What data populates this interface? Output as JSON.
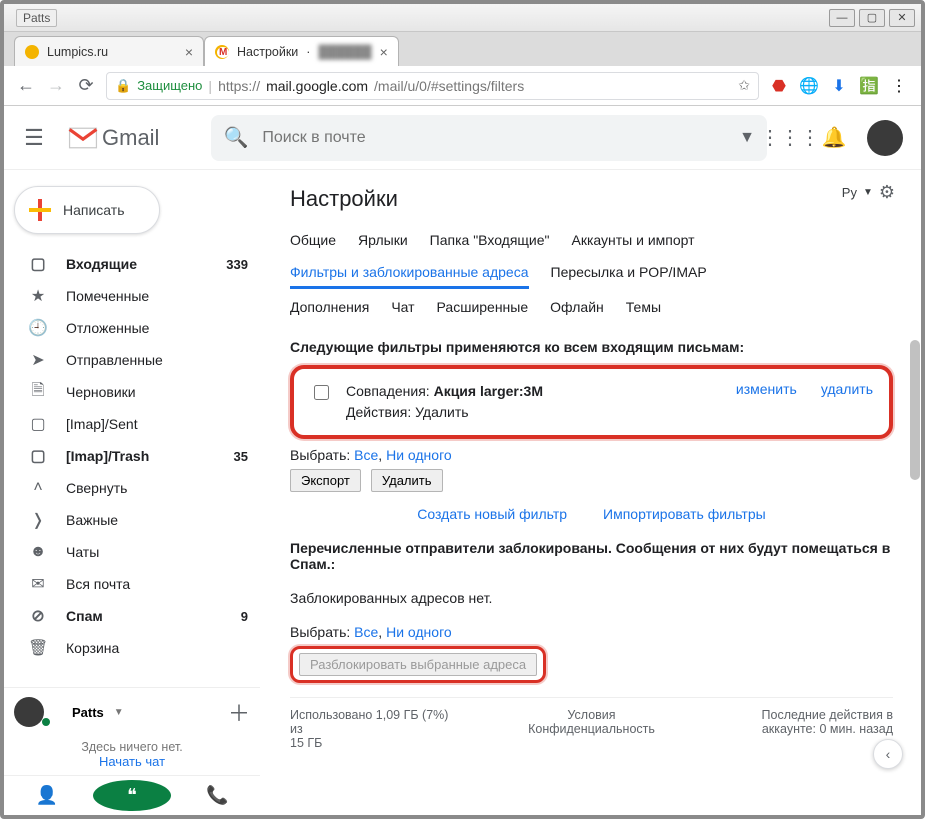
{
  "window": {
    "app_label": "Patts"
  },
  "browser": {
    "tabs": [
      {
        "title": "Lumpics.ru"
      },
      {
        "title": "Настройки"
      }
    ],
    "url_secure": "Защищено",
    "url_host": "https://",
    "url_main": "mail.google.com",
    "url_path": "/mail/u/0/#settings/filters"
  },
  "header": {
    "brand": "Gmail",
    "search_placeholder": "Поиск в почте"
  },
  "compose_label": "Написать",
  "sidebar": {
    "items": [
      {
        "label": "Входящие",
        "count": "339",
        "bold": true,
        "icon": "▢"
      },
      {
        "label": "Помеченные",
        "count": "",
        "bold": false,
        "icon": "★"
      },
      {
        "label": "Отложенные",
        "count": "",
        "bold": false,
        "icon": "🕘"
      },
      {
        "label": "Отправленные",
        "count": "",
        "bold": false,
        "icon": "➤"
      },
      {
        "label": "Черновики",
        "count": "",
        "bold": false,
        "icon": "🗎"
      },
      {
        "label": "[Imap]/Sent",
        "count": "",
        "bold": false,
        "icon": "▢"
      },
      {
        "label": "[Imap]/Trash",
        "count": "35",
        "bold": true,
        "icon": "▢"
      },
      {
        "label": "Свернуть",
        "count": "",
        "bold": false,
        "icon": "˄"
      },
      {
        "label": "Важные",
        "count": "",
        "bold": false,
        "icon": "❭"
      },
      {
        "label": "Чаты",
        "count": "",
        "bold": false,
        "icon": "☻"
      },
      {
        "label": "Вся почта",
        "count": "",
        "bold": false,
        "icon": "✉"
      },
      {
        "label": "Спам",
        "count": "9",
        "bold": true,
        "icon": "⊘"
      },
      {
        "label": "Корзина",
        "count": "",
        "bold": false,
        "icon": "🗑"
      }
    ]
  },
  "hangouts": {
    "user": "Patts",
    "empty": "Здесь ничего нет.",
    "start_chat": "Начать чат"
  },
  "settings": {
    "title": "Настройки",
    "lang": "Ру",
    "tabs": {
      "general": "Общие",
      "labels": "Ярлыки",
      "inbox": "Папка \"Входящие\"",
      "accounts": "Аккаунты и импорт",
      "filters": "Фильтры и заблокированные адреса",
      "forwarding": "Пересылка и POP/IMAP",
      "addons": "Дополнения",
      "chat": "Чат",
      "advanced": "Расширенные",
      "offline": "Офлайн",
      "themes": "Темы"
    },
    "filters_heading": "Следующие фильтры применяются ко всем входящим письмам:",
    "filter": {
      "match_label": "Совпадения:",
      "match_value": "Акция larger:3M",
      "action_label": "Действия:",
      "action_value": "Удалить",
      "edit": "изменить",
      "delete": "удалить"
    },
    "select_label": "Выбрать:",
    "select_all": "Все",
    "select_none": "Ни одного",
    "export_btn": "Экспорт",
    "delete_btn": "Удалить",
    "create_filter": "Создать новый фильтр",
    "import_filters": "Импортировать фильтры",
    "blocked_heading": "Перечисленные отправители заблокированы. Сообщения от них будут помещаться в Спам.:",
    "no_blocked": "Заблокированных адресов нет.",
    "unblock_btn": "Разблокировать выбранные адреса"
  },
  "footer": {
    "storage1": "Использовано 1,09 ГБ (7%) из",
    "storage2": "15 ГБ",
    "terms": "Условия",
    "privacy": "Конфиденциальность",
    "activity1": "Последние действия в",
    "activity2": "аккаунте: 0 мин. назад"
  }
}
